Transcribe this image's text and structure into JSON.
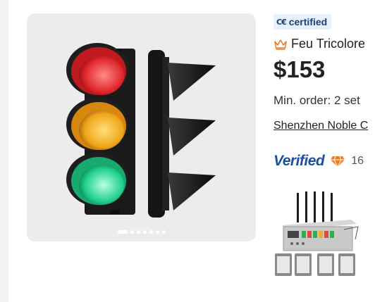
{
  "product": {
    "gallery": {
      "image": "traffic-light-product-photo",
      "dot_count": 7,
      "active_index": 0
    },
    "badge": {
      "icon": "ce-mark-icon",
      "label": "certified"
    },
    "title_icon": "crown-icon",
    "title": "Feu Tricolore",
    "price": "$153",
    "min_order": "Min. order: 2 set",
    "supplier": "Shenzhen Noble C",
    "verified_label": "Verified",
    "years": "16",
    "thumbnail": {
      "image": "signal-device-photo"
    },
    "colors": {
      "badge_bg": "#e6f1fd",
      "badge_text": "#1d3f75",
      "verified": "#1d4f9b",
      "crown": "#e07a2c",
      "diamond": "#ef7b1a"
    }
  }
}
